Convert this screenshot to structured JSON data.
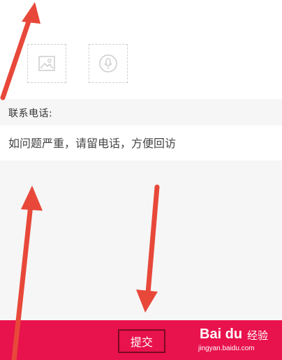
{
  "attachments": {
    "image_icon": "image-icon",
    "voice_icon": "microphone-icon"
  },
  "contact": {
    "label": "联系电话:",
    "placeholder": "如问题严重，请留电话，方便回访",
    "value": ""
  },
  "footer": {
    "submit_label": "提交"
  },
  "watermark": {
    "logo": "Bai du",
    "text": "经验",
    "url": "jingyan.baidu.com"
  },
  "colors": {
    "accent": "#e8124c",
    "arrow": "#e8483a",
    "border": "#cfcfcf"
  }
}
